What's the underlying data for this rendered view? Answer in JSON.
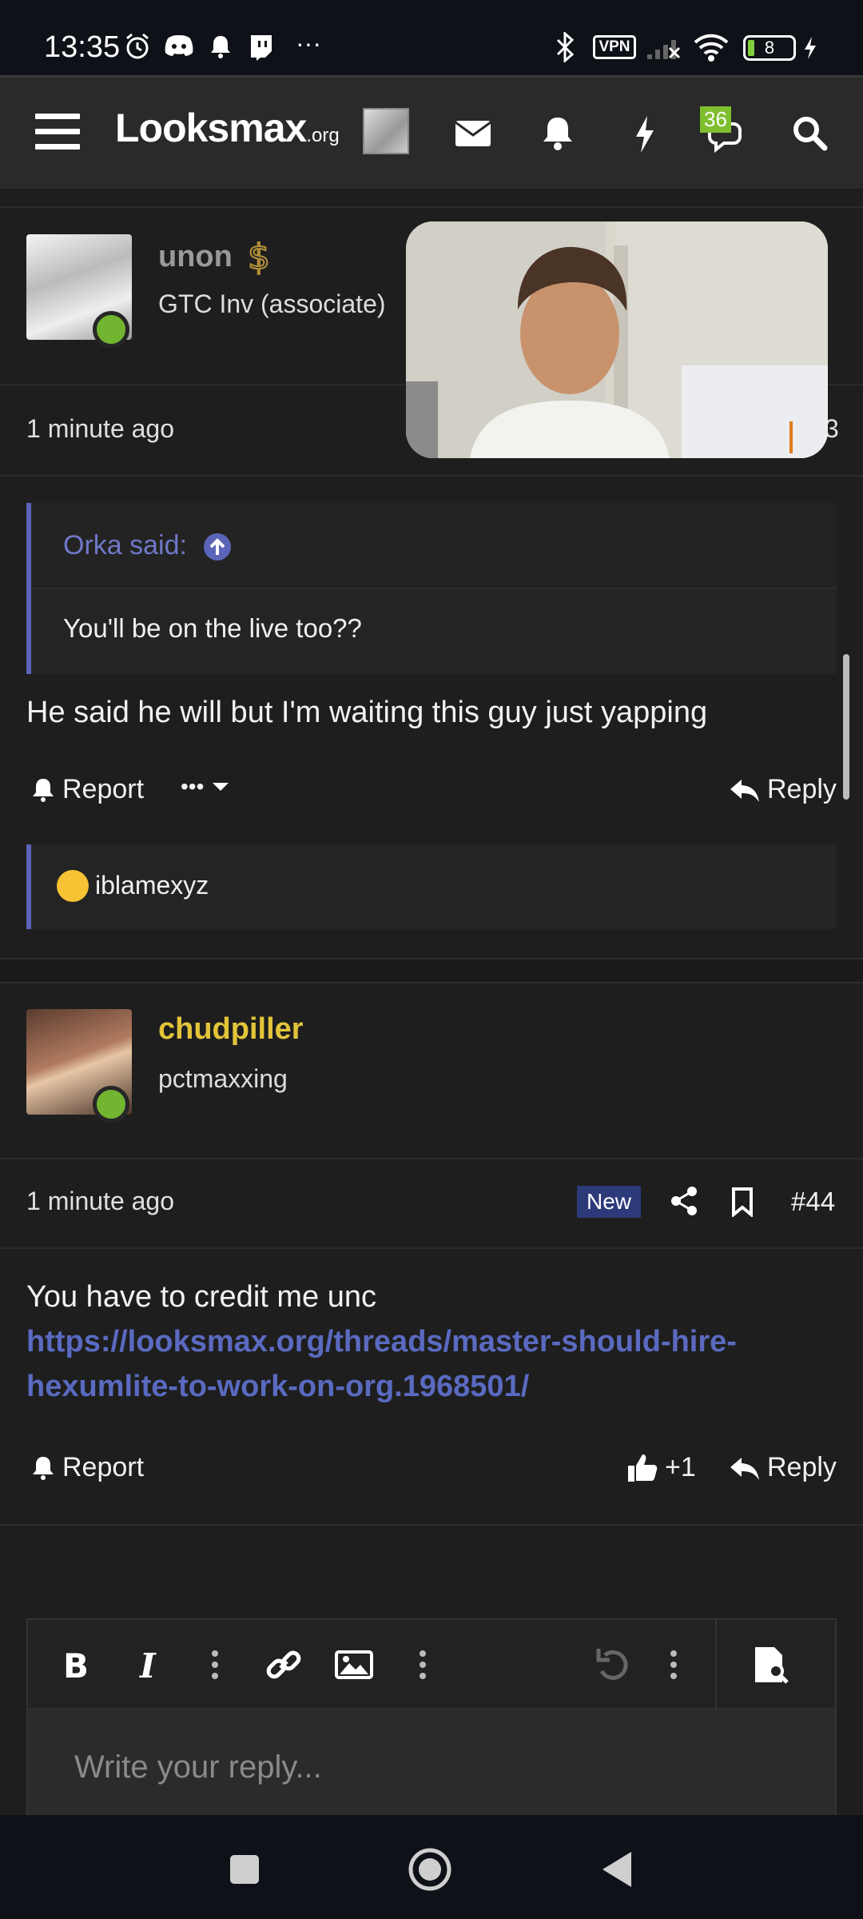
{
  "status_bar": {
    "time": "13:35",
    "vpn": "VPN",
    "battery": "8",
    "more": "···"
  },
  "header": {
    "logo_main": "Looksmax",
    "logo_suffix": ".org",
    "conversations_badge": "36",
    "icons": [
      "menu-icon",
      "envelope-icon",
      "bell-icon",
      "lightning-icon",
      "chat-icon",
      "search-icon"
    ]
  },
  "post1": {
    "username": "unon",
    "user_title": "GTC Inv (associate)",
    "time": "1 minute ago",
    "partial_num": "3",
    "quote_author": "Orka said:",
    "quote_text": "You'll be on the live too??",
    "text": "He said he will but I'm waiting this guy just yapping",
    "report": "Report",
    "more": "•••",
    "reply": "Reply",
    "reaction_user": "iblamexyz"
  },
  "post2": {
    "username": "chudpiller",
    "user_title": "pctmaxxing",
    "time": "1 minute ago",
    "new_label": "New",
    "post_number": "#44",
    "text_line1": "You have to credit me unc",
    "link_line1": "https://looksmax.org/threads/master-should-hire-",
    "link_line2": "hexumlite-to-work-on-org.1968501/",
    "report": "Report",
    "reaction_count": "+1",
    "reply": "Reply"
  },
  "editor": {
    "placeholder": "Write your reply..."
  },
  "colors": {
    "accent": "#5a64b8",
    "username_gold": "#e2c43a",
    "online_green": "#72b531",
    "background": "#1e1e1e"
  }
}
